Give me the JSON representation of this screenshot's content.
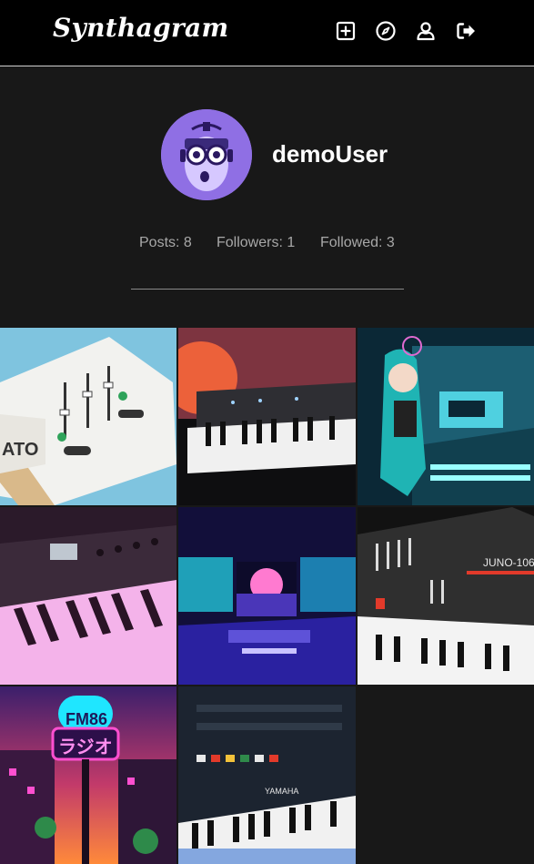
{
  "app": {
    "title": "Synthagram"
  },
  "nav": {
    "icons": [
      "new-post-icon",
      "explore-icon",
      "profile-icon",
      "logout-icon"
    ]
  },
  "profile": {
    "username": "demoUser",
    "stats": {
      "posts": "Posts: 8",
      "followers": "Followers: 1",
      "followed": "Followed: 3"
    }
  },
  "colors": {
    "navbar_bg": "#000000",
    "page_bg": "#181818",
    "stat_text": "#a8a8a8",
    "avatar_bg": "#9b7ce8"
  }
}
